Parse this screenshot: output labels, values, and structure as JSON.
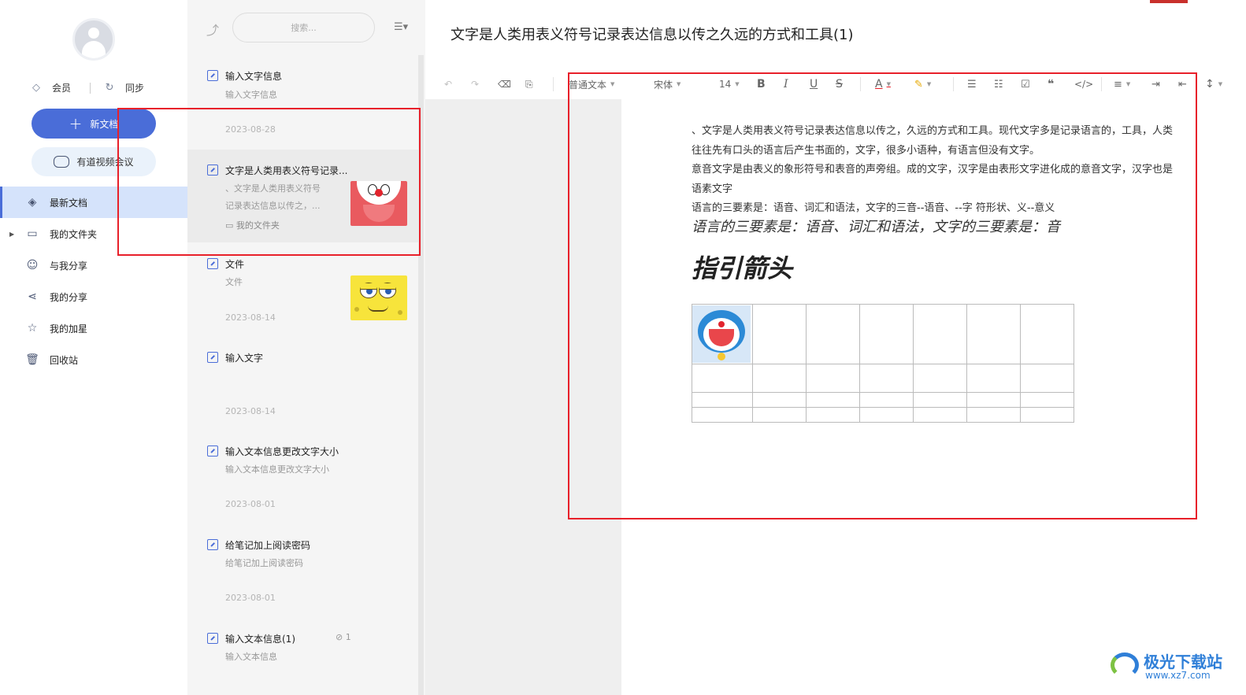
{
  "sidebar": {
    "vip_label": "会员",
    "sync_label": "同步",
    "new_doc_label": "新文档",
    "video_meeting_label": "有道视频会议",
    "nav": [
      {
        "label": "最新文档",
        "icon": "layers-icon",
        "active": true
      },
      {
        "label": "我的文件夹",
        "icon": "folder-icon"
      },
      {
        "label": "与我分享",
        "icon": "shared-users-icon"
      },
      {
        "label": "我的分享",
        "icon": "share-icon"
      },
      {
        "label": "我的加星",
        "icon": "star-icon"
      },
      {
        "label": "回收站",
        "icon": "trash-icon"
      }
    ]
  },
  "list": {
    "search_placeholder": "搜索...",
    "docs": [
      {
        "title": "输入文字信息",
        "snippet": "输入文字信息",
        "date": "2023-08-28"
      },
      {
        "title": "文字是人类用表义符号记录...",
        "snippet_line1": "、文字是人类用表义符号",
        "snippet_line2": "记录表达信息以传之，...",
        "folder": "我的文件夹",
        "thumb": "doraemon"
      },
      {
        "title": "文件",
        "snippet": "文件",
        "date": "2023-08-14",
        "thumb": "spongebob"
      },
      {
        "title": "输入文字",
        "date": "2023-08-14"
      },
      {
        "title": "输入文本信息更改文字大小",
        "snippet": "输入文本信息更改文字大小",
        "date": "2023-08-01"
      },
      {
        "title": "给笔记加上阅读密码",
        "snippet": "给笔记加上阅读密码",
        "date": "2023-08-01"
      },
      {
        "title": "输入文本信息(1)",
        "snippet": "输入文本信息",
        "attachments": "1"
      }
    ]
  },
  "editor": {
    "title": "文字是人类用表义符号记录表达信息以传之久远的方式和工具(1)",
    "toolbar": {
      "paragraph_style": "普通文本",
      "font": "宋体",
      "font_size": "14"
    },
    "body": {
      "para1": "、文字是人类用表义符号记录表达信息以传之，久远的方式和工具。现代文字多是记录语言的，工具，人类往往先有口头的语言后产生书面的，文字，很多小语种，有语言但没有文字。",
      "para2": "意音文字是由表义的象形符号和表音的声旁组。成的文字，汉字是由表形文字进化成的意音文字，汉字也是语素文字",
      "para3": "语言的三要素是：语音、词汇和语法，文字的三音--语音、--字 符形状、义--意义",
      "para4": "语言的三要素是：语音、词汇和语法，文字的三要素是：音",
      "heading": "指引箭头"
    }
  },
  "watermark": {
    "brand": "极光下载站",
    "url": "www.xz7.com"
  }
}
